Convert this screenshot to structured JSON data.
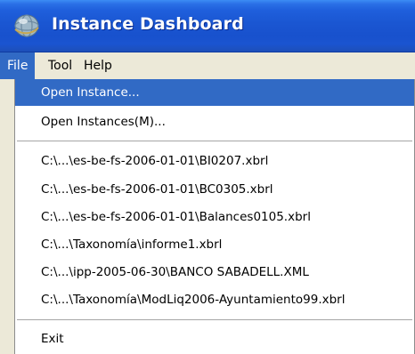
{
  "window": {
    "title": "Instance Dashboard",
    "icon": "globe-app-icon"
  },
  "menubar": {
    "items": [
      {
        "label": "File",
        "active": true
      },
      {
        "label": "Tool",
        "active": false
      },
      {
        "label": "Help",
        "active": false
      }
    ]
  },
  "file_menu": {
    "open_instance": "Open Instance...",
    "open_instances": "Open Instances(M)...",
    "recent_files": [
      "C:\\...\\es-be-fs-2006-01-01\\BI0207.xbrl",
      "C:\\...\\es-be-fs-2006-01-01\\BC0305.xbrl",
      "C:\\...\\es-be-fs-2006-01-01\\Balances0105.xbrl",
      "C:\\...\\Taxonomía\\informe1.xbrl",
      "C:\\...\\ipp-2005-06-30\\BANCO SABADELL.XML",
      "C:\\...\\Taxonomía\\ModLiq2006-Ayuntamiento99.xbrl"
    ],
    "exit": "Exit"
  },
  "colors": {
    "title_bar": "#1a56d2",
    "menu_highlight": "#316ac5",
    "menubar_bg": "#ece9d8"
  }
}
